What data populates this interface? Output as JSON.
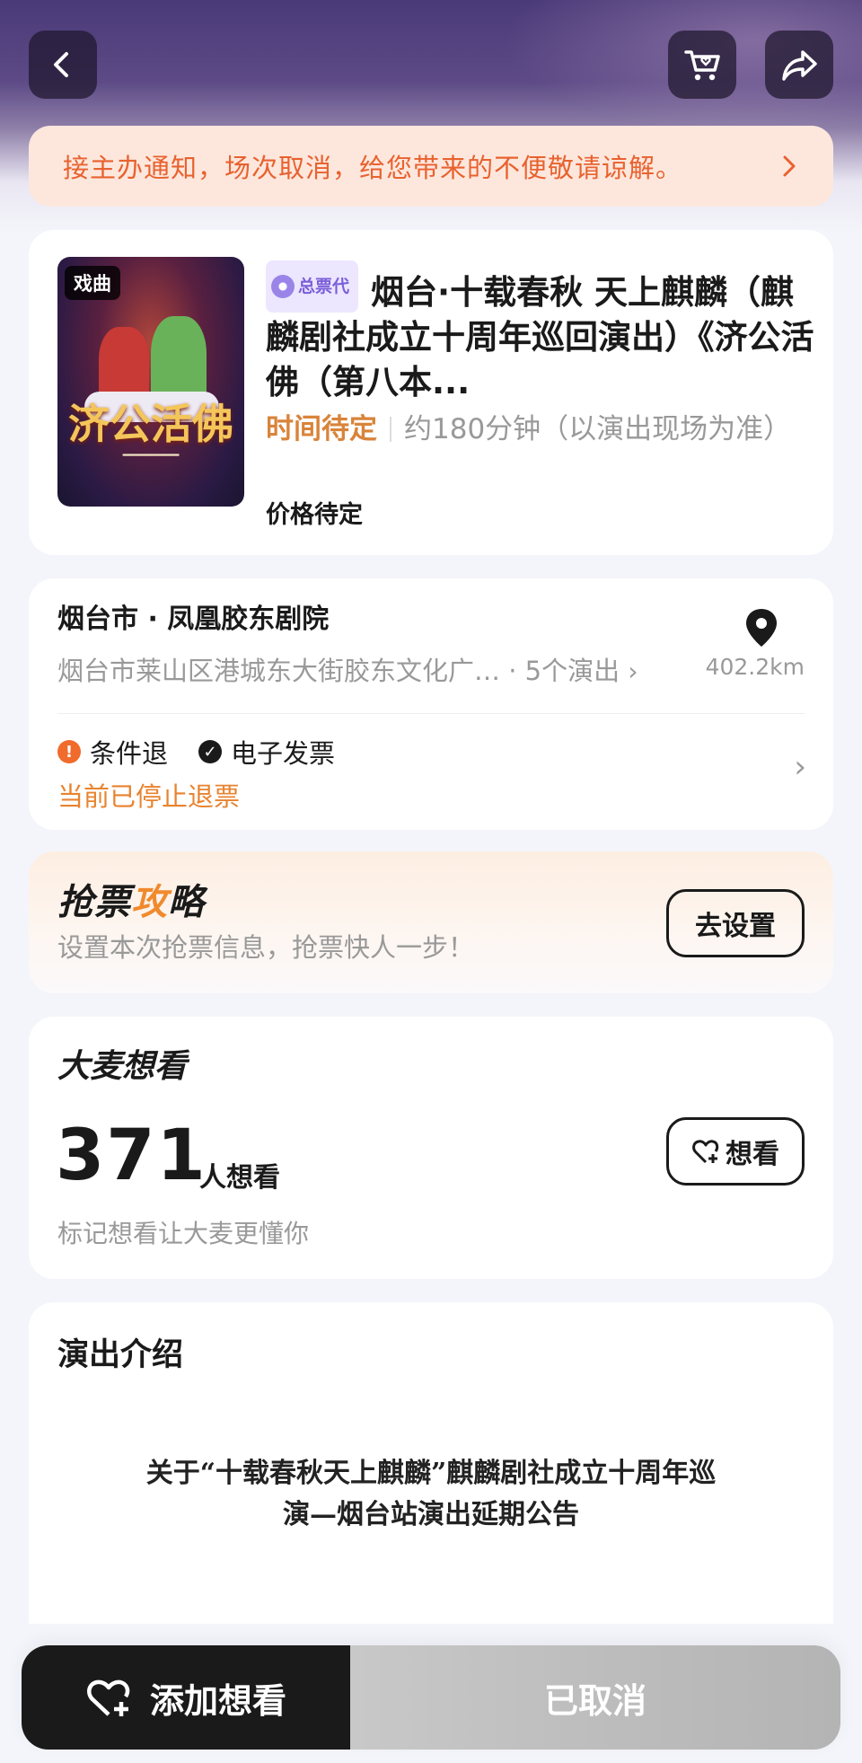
{
  "notice": {
    "text": "接主办通知，场次取消，给您带来的不便敬请谅解。"
  },
  "show": {
    "poster_tag": "戏曲",
    "poster_title": "济公活佛",
    "agent_badge": "总票代",
    "title": "烟台·十载春秋 天上麒麟（麒麟剧社成立十周年巡回演出）《济公活佛（第八本...",
    "time": "时间待定",
    "duration": "约180分钟（以演出现场为准）",
    "price": "价格待定"
  },
  "venue": {
    "name": "烟台市 · 凤凰胶东剧院",
    "address": "烟台市莱山区港城东大街胶东文化广…",
    "show_count": "· 5个演出",
    "distance": "402.2km",
    "tag_refund": "条件退",
    "tag_invoice": "电子发票",
    "refund_status": "当前已停止退票"
  },
  "guide": {
    "title_a": "抢票",
    "title_b": "攻",
    "title_c": "略",
    "subtitle": "设置本次抢票信息，抢票快人一步！",
    "button": "去设置"
  },
  "want": {
    "title_a": "大麦想",
    "title_b": "看",
    "count": "371",
    "unit": "人想看",
    "hint": "标记想看让大麦更懂你",
    "button": "想看"
  },
  "intro": {
    "title": "演出介绍",
    "announcement_line1": "关于“十载春秋天上麒麟”麒麟剧社成立十周年巡",
    "announcement_line2": "演—烟台站演出延期公告"
  },
  "bottom": {
    "add_want": "添加想看",
    "status": "已取消"
  },
  "colors": {
    "accent_orange": "#e8622f",
    "brand_purple": "#7b5fd9",
    "dark": "#1a1a1a"
  }
}
